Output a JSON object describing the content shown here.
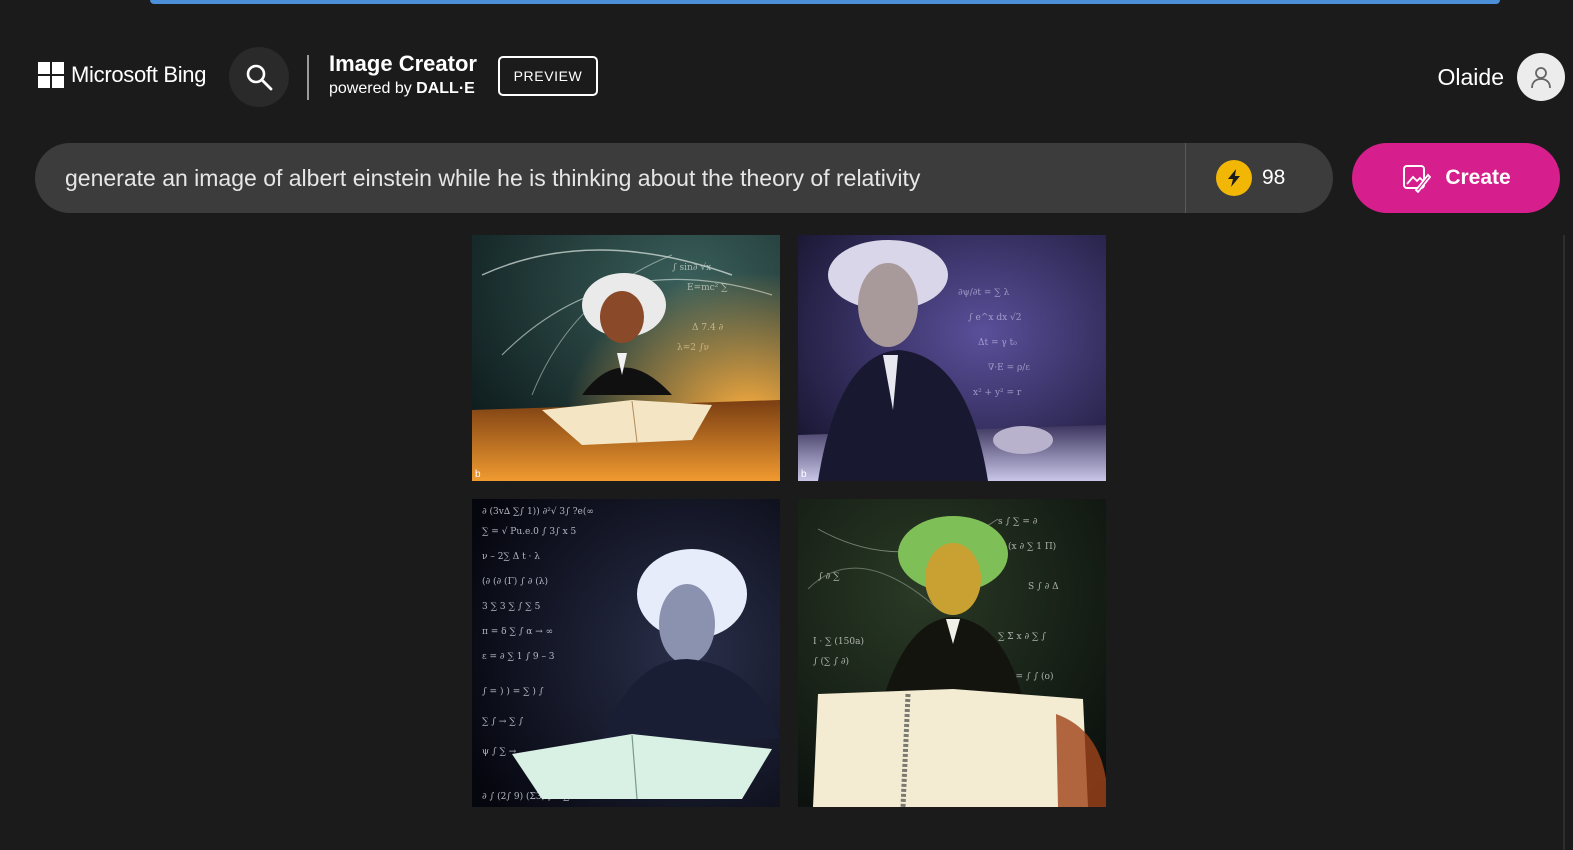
{
  "header": {
    "brand_label": "Microsoft Bing",
    "product_title": "Image Creator",
    "product_powered": "powered by",
    "product_engine": "DALL·E",
    "preview_badge": "PREVIEW",
    "user_name": "Olaide"
  },
  "prompt": {
    "value": "generate an image of albert einstein while he is thinking about the theory of relativity",
    "boosts": "98"
  },
  "actions": {
    "create_label": "Create"
  },
  "results": {
    "watermark": "b",
    "images": [
      {
        "name": "result-image-1",
        "palette": [
          "#142528",
          "#3a5f5a",
          "#f0a13a",
          "#f4e6c4"
        ]
      },
      {
        "name": "result-image-2",
        "palette": [
          "#1d1a3a",
          "#5a4f9a",
          "#c9c6e8",
          "#e9e3f4"
        ]
      },
      {
        "name": "result-image-3",
        "palette": [
          "#0a0c18",
          "#2a2f4a",
          "#d8dff2",
          "#ffffff"
        ]
      },
      {
        "name": "result-image-4",
        "palette": [
          "#0f1a12",
          "#3a5a2a",
          "#f1d15c",
          "#f3ecd2"
        ]
      }
    ]
  },
  "colors": {
    "background": "#1b1b1b",
    "prompt_bg": "#3c3c3c",
    "accent_create": "#d61e8c",
    "boost_coin": "#f2b705"
  }
}
